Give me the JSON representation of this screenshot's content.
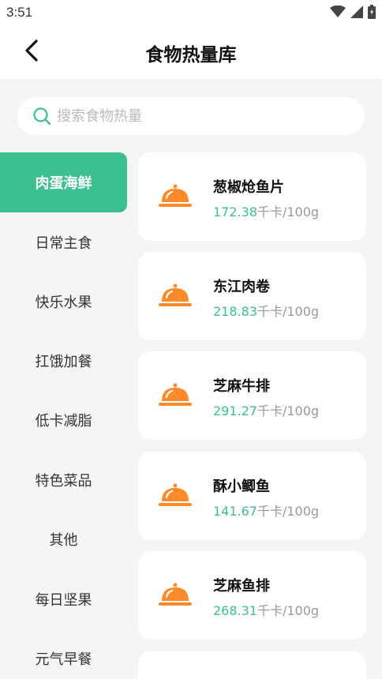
{
  "status_bar": {
    "time": "3:51",
    "icons": [
      "wifi-icon",
      "signal-icon",
      "battery-icon"
    ]
  },
  "header": {
    "title": "食物热量库",
    "back_icon": "chevron-left-icon"
  },
  "search": {
    "placeholder": "搜索食物热量",
    "value": "",
    "icon": "search-icon"
  },
  "categories": [
    {
      "label": "肉蛋海鲜",
      "active": true
    },
    {
      "label": "日常主食",
      "active": false
    },
    {
      "label": "快乐水果",
      "active": false
    },
    {
      "label": "扛饿加餐",
      "active": false
    },
    {
      "label": "低卡减脂",
      "active": false
    },
    {
      "label": "特色菜品",
      "active": false
    },
    {
      "label": "其他",
      "active": false
    },
    {
      "label": "每日坚果",
      "active": false
    },
    {
      "label": "元气早餐",
      "active": false
    }
  ],
  "foods": [
    {
      "name": "葱椒炝鱼片",
      "calories": "172.38",
      "unit": "千卡/100g",
      "icon": "food-cloche-icon"
    },
    {
      "name": "东江肉卷",
      "calories": "218.83",
      "unit": "千卡/100g",
      "icon": "food-cloche-icon"
    },
    {
      "name": "芝麻牛排",
      "calories": "291.27",
      "unit": "千卡/100g",
      "icon": "food-cloche-icon"
    },
    {
      "name": "酥小鲫鱼",
      "calories": "141.67",
      "unit": "千卡/100g",
      "icon": "food-cloche-icon"
    },
    {
      "name": "芝麻鱼排",
      "calories": "268.31",
      "unit": "千卡/100g",
      "icon": "food-cloche-icon"
    }
  ],
  "colors": {
    "accent": "#3cc08f",
    "icon_orange": "#ff8a2a",
    "background": "#f4f5f7"
  }
}
